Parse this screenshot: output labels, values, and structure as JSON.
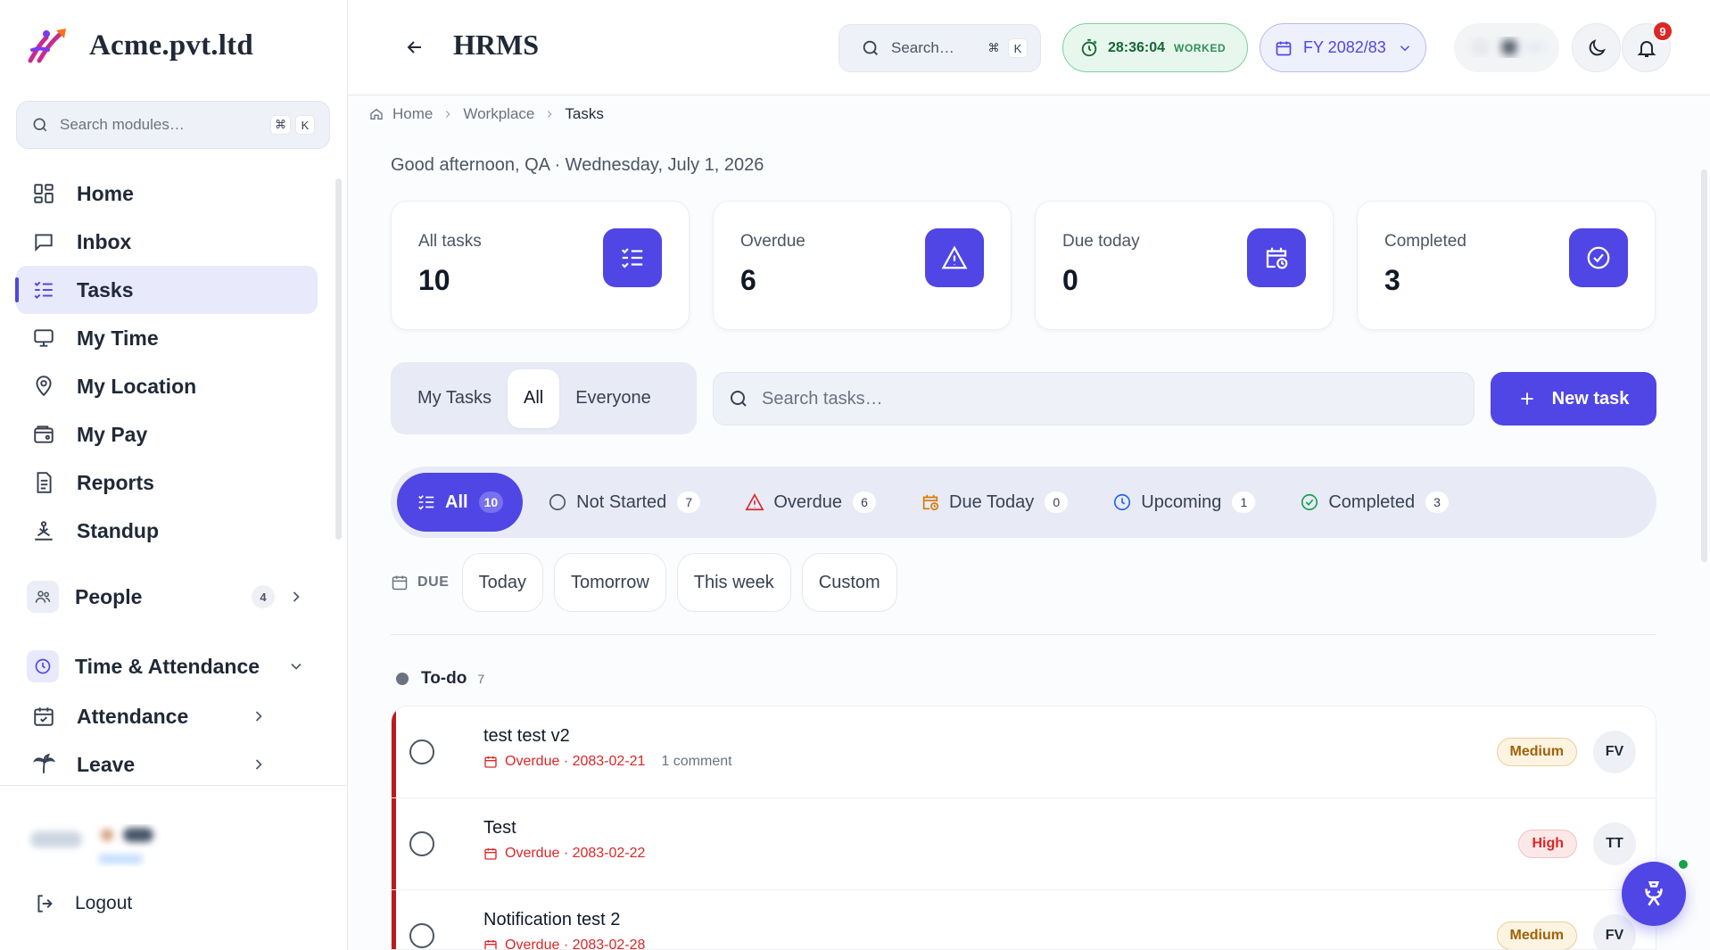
{
  "brand": {
    "name": "Acme.pvt.ltd",
    "logo_icon": "brand-logo-icon"
  },
  "sidebar": {
    "search": {
      "placeholder": "Search modules…",
      "shortcut_mod": "⌘",
      "shortcut_key": "K"
    },
    "items": [
      {
        "label": "Home",
        "icon": "grid-icon"
      },
      {
        "label": "Inbox",
        "icon": "inbox-icon"
      },
      {
        "label": "Tasks",
        "icon": "checklist-icon",
        "active": true
      },
      {
        "label": "My Time",
        "icon": "monitor-icon"
      },
      {
        "label": "My Location",
        "icon": "location-pin-icon"
      },
      {
        "label": "My Pay",
        "icon": "wallet-icon"
      },
      {
        "label": "Reports",
        "icon": "document-icon"
      },
      {
        "label": "Standup",
        "icon": "standup-icon"
      }
    ],
    "groups": [
      {
        "label": "People",
        "badge": "4",
        "icon": "people-icon"
      },
      {
        "label": "Time & Attendance",
        "icon": "clock-icon"
      }
    ],
    "sub_items": [
      {
        "label": "Attendance",
        "icon": "calendar-check-icon"
      },
      {
        "label": "Leave",
        "icon": "palm-tree-icon"
      }
    ],
    "logout": "Logout"
  },
  "topbar": {
    "title": "HRMS",
    "search": {
      "placeholder": "Search…",
      "shortcut_mod": "⌘",
      "shortcut_key": "K"
    },
    "worked": {
      "time": "28:36:04",
      "label": "WORKED"
    },
    "fiscal_year": "FY 2082/83",
    "notifications_count": "9"
  },
  "breadcrumb": {
    "home": "Home",
    "section": "Workplace",
    "current": "Tasks"
  },
  "greeting": "Good afternoon, QA · Wednesday, July 1, 2026",
  "stats": [
    {
      "label": "All tasks",
      "value": "10",
      "icon": "checklist-icon"
    },
    {
      "label": "Overdue",
      "value": "6",
      "icon": "warning-icon"
    },
    {
      "label": "Due today",
      "value": "0",
      "icon": "calendar-clock-icon"
    },
    {
      "label": "Completed",
      "value": "3",
      "icon": "check-circle-icon"
    }
  ],
  "scope": {
    "options": [
      "My Tasks",
      "All",
      "Everyone"
    ],
    "selected": "All"
  },
  "task_search": {
    "placeholder": "Search tasks…"
  },
  "new_task_label": "New task",
  "filters": [
    {
      "label": "All",
      "count": "10",
      "icon": "checklist-icon",
      "selected": true
    },
    {
      "label": "Not Started",
      "count": "7",
      "icon": "circle-icon"
    },
    {
      "label": "Overdue",
      "count": "6",
      "icon": "warning-icon",
      "color": "#dc2626"
    },
    {
      "label": "Due Today",
      "count": "0",
      "icon": "calendar-clock-icon",
      "color": "#d97706"
    },
    {
      "label": "Upcoming",
      "count": "1",
      "icon": "clock-icon",
      "color": "#2563eb"
    },
    {
      "label": "Completed",
      "count": "3",
      "icon": "check-circle-icon",
      "color": "#16a34a"
    }
  ],
  "due": {
    "label": "DUE",
    "options": [
      "Today",
      "Tomorrow",
      "This week",
      "Custom"
    ]
  },
  "section": {
    "name": "To-do",
    "count": "7"
  },
  "tasks": [
    {
      "title": "test test v2",
      "status": "Overdue · 2083-02-21",
      "comments": "1 comment",
      "priority": "Medium",
      "assignee": "FV"
    },
    {
      "title": "Test",
      "status": "Overdue · 2083-02-22",
      "comments": "",
      "priority": "High",
      "assignee": "TT"
    },
    {
      "title": "Notification test 2",
      "status": "Overdue · 2083-02-28",
      "comments": "",
      "priority": "Medium",
      "assignee": "FV"
    }
  ],
  "colors": {
    "accent": "#4f46e5",
    "overdue": "#dc2626",
    "worked_green": "#166534"
  }
}
